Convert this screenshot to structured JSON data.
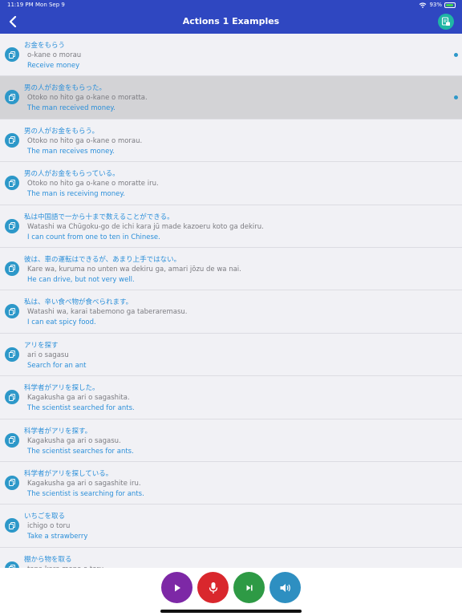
{
  "status_bar": {
    "time": "11:19 PM",
    "date": "Mon Sep 9",
    "battery_percent": "93%",
    "battery_level": 0.93
  },
  "header": {
    "title": "Actions 1 Examples",
    "back_icon": "chevron-left-icon",
    "export_icon": "document-export-icon"
  },
  "colors": {
    "header_bg": "#2f47c1",
    "accent_text": "#2b8fd9",
    "row_icon": "#2d98c9",
    "selected_row": "#d3d3d6",
    "play": "#7d28a6",
    "mic": "#d9272d",
    "next": "#2e9a45",
    "speaker": "#2e8fc1"
  },
  "examples": [
    {
      "jp": "お金をもらう",
      "romaji": "o-kane o morau",
      "en": "Receive money",
      "dot": true,
      "selected": false
    },
    {
      "jp": "男の人がお金をもらった。",
      "romaji": "Otoko no hito ga o-kane o moratta.",
      "en": "The man received money.",
      "dot": true,
      "selected": true
    },
    {
      "jp": "男の人がお金をもらう。",
      "romaji": "Otoko no hito ga o-kane o morau.",
      "en": "The man receives money.",
      "dot": false,
      "selected": false
    },
    {
      "jp": "男の人がお金をもらっている。",
      "romaji": "Otoko no hito ga o-kane o moratte iru.",
      "en": "The man is receiving money.",
      "dot": false,
      "selected": false
    },
    {
      "jp": "私は中国語で一から十まで数えることができる。",
      "romaji": "Watashi wa Chūgoku-go de ichi kara jū made kazoeru koto ga dekiru.",
      "en": "I can count from one to ten in Chinese.",
      "dot": false,
      "selected": false
    },
    {
      "jp": "彼は、車の運転はできるが、あまり上手ではない。",
      "romaji": "Kare wa, kuruma no unten wa dekiru ga, amari jōzu de wa nai.",
      "en": "He can drive, but not very well.",
      "dot": false,
      "selected": false
    },
    {
      "jp": "私は、辛い食べ物が食べられます。",
      "romaji": "Watashi wa, karai tabemono ga taberaremasu.",
      "en": "I can eat spicy food.",
      "dot": false,
      "selected": false
    },
    {
      "jp": "アリを探す",
      "romaji": "ari o sagasu",
      "en": "Search for an ant",
      "dot": false,
      "selected": false
    },
    {
      "jp": "科学者がアリを探した。",
      "romaji": "Kagakusha ga ari o sagashita.",
      "en": "The scientist searched for ants.",
      "dot": false,
      "selected": false
    },
    {
      "jp": "科学者がアリを探す。",
      "romaji": "Kagakusha ga ari o sagasu.",
      "en": "The scientist searches for ants.",
      "dot": false,
      "selected": false
    },
    {
      "jp": "科学者がアリを探している。",
      "romaji": "Kagakusha ga ari o sagashite iru.",
      "en": "The scientist is searching for ants.",
      "dot": false,
      "selected": false
    },
    {
      "jp": "いちごを取る",
      "romaji": "ichigo o toru",
      "en": "Take a strawberry",
      "dot": false,
      "selected": false
    },
    {
      "jp": "棚から物を取る",
      "romaji": "tana kara mono o toru",
      "en": "",
      "dot": false,
      "selected": false
    }
  ],
  "controls": [
    {
      "name": "play-button",
      "icon": "play-icon",
      "color": "#7d28a6"
    },
    {
      "name": "mic-button",
      "icon": "microphone-icon",
      "color": "#d9272d"
    },
    {
      "name": "next-button",
      "icon": "skip-next-icon",
      "color": "#2e9a45"
    },
    {
      "name": "speaker-button",
      "icon": "speaker-icon",
      "color": "#2e8fc1"
    }
  ]
}
